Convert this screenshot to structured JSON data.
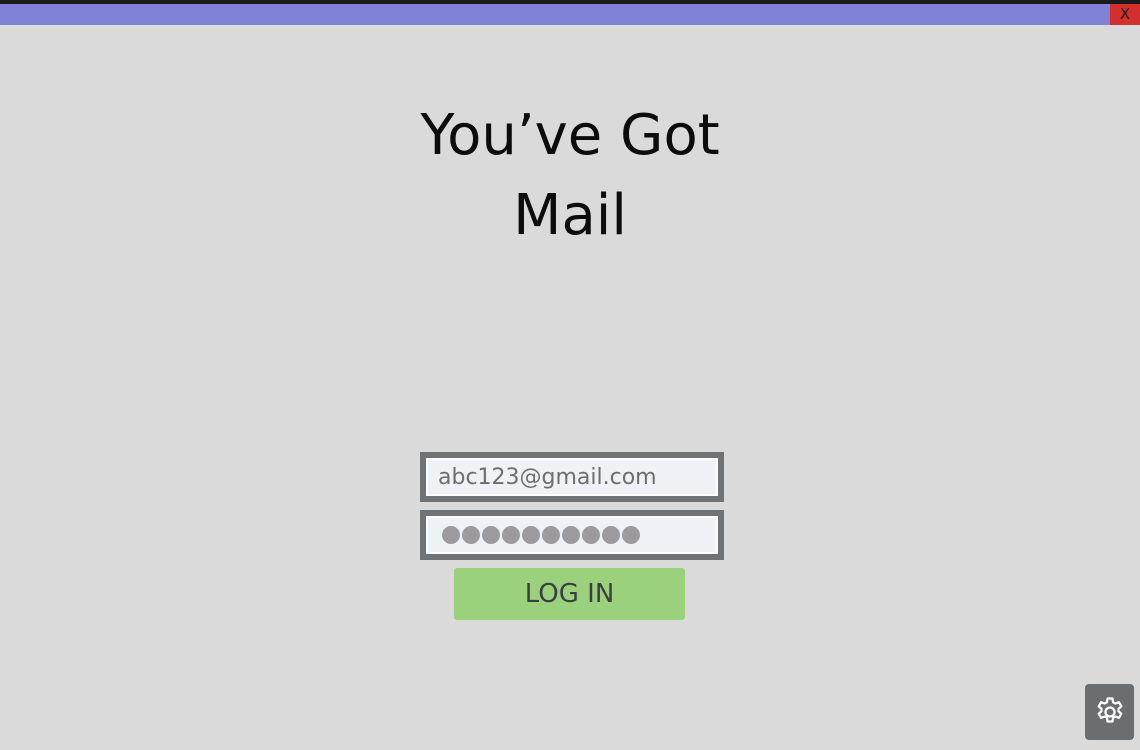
{
  "window": {
    "close_label": "X",
    "colors": {
      "title_bar": "#7f82d6",
      "close_button": "#d42f2f",
      "background": "#dadada"
    }
  },
  "main": {
    "title_line1": "You’ve Got",
    "title_line2": "Mail"
  },
  "login_form": {
    "email_value": "abc123@gmail.com",
    "password_masked_length": 10,
    "login_label": "LOG IN",
    "login_color": "#9bd07d"
  },
  "settings": {
    "icon": "gear-icon"
  }
}
